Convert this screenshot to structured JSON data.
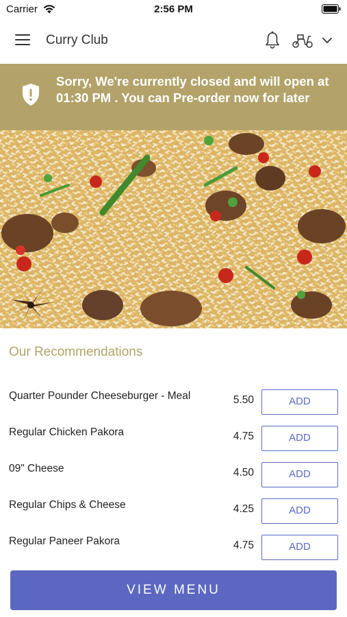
{
  "status_bar": {
    "carrier": "Carrier",
    "time": "2:56 PM"
  },
  "header": {
    "title": "Curry Club",
    "icons": [
      "menu-icon",
      "bell-icon",
      "scooter-icon",
      "chevron-down-icon"
    ]
  },
  "banner": {
    "text": "Sorry, We're currently closed and will open at 01:30 PM . You can Pre-order now for later",
    "background": "#b3a36a",
    "icon": "shield-icon"
  },
  "recommendations": {
    "title": "Our Recommendations",
    "items": [
      {
        "name": "Quarter Pounder Cheeseburger - Meal",
        "price": "5.50",
        "button": "ADD"
      },
      {
        "name": "Regular Chicken Pakora",
        "price": "4.75",
        "button": "ADD"
      },
      {
        "name": "09\" Cheese",
        "price": "4.50",
        "button": "ADD"
      },
      {
        "name": "Regular Chips & Cheese",
        "price": "4.25",
        "button": "ADD"
      },
      {
        "name": "Regular Paneer Pakora",
        "price": "4.75",
        "button": "ADD"
      }
    ]
  },
  "footer": {
    "view_menu_label": "VIEW MENU"
  },
  "colors": {
    "accent": "#5b67c0",
    "banner": "#b3a36a",
    "section_title": "#b3a36a"
  }
}
